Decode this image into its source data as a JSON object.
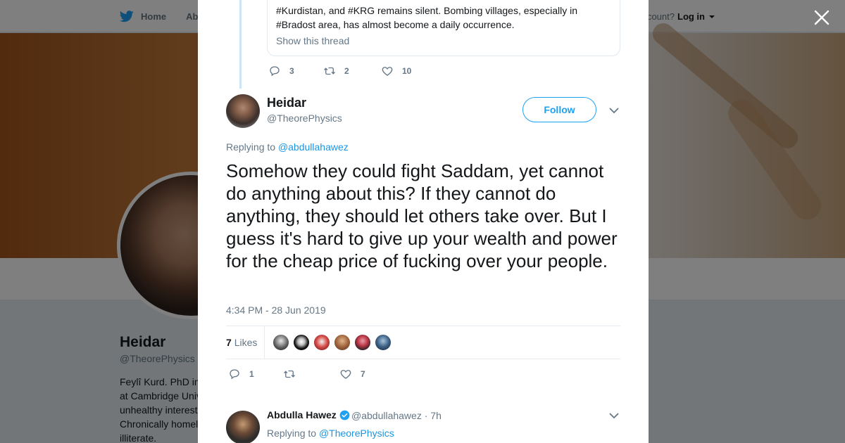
{
  "background": {
    "nav": {
      "home": "Home",
      "about": "Abo"
    },
    "account_question": "ccount?",
    "login": "Log in",
    "profile_name": "Heidar",
    "profile_handle": "@TheorePhysics",
    "bio": "Feylî Kurd. PhD in\nat Cambridge Univ\nunhealthy interest\nChronically homel\nilliterate."
  },
  "quoted_tweet": {
    "text": "#Kurdistan, and #KRG remains silent. Bombing villages, especially in #Bradost area, has almost become a daily occurrence.",
    "show_thread": "Show this thread",
    "replies": "3",
    "retweets": "2",
    "likes": "10"
  },
  "tweet": {
    "author_name": "Heidar",
    "author_handle": "@TheorePhysics",
    "follow_label": "Follow",
    "replying_prefix": "Replying to",
    "replying_to": "@abdullahawez",
    "text": "Somehow they could fight Saddam, yet cannot do anything about this? If they cannot do anything, they should let others take over. But I guess it's hard to give up your wealth and power for the cheap price of fucking over your people.",
    "timestamp": "4:34 PM - 28 Jun 2019",
    "likes_count": "7",
    "likes_label": "Likes",
    "reply_count": "1",
    "like_count": "7"
  },
  "reply": {
    "author_name": "Abdulla Hawez",
    "author_handle": "@abdullahawez",
    "time": "· 7h",
    "replying_prefix": "Replying to",
    "replying_to": "@TheorePhysics"
  },
  "colors": {
    "accent": "#1da1f2",
    "link": "#1b95e0",
    "muted": "#657786"
  }
}
